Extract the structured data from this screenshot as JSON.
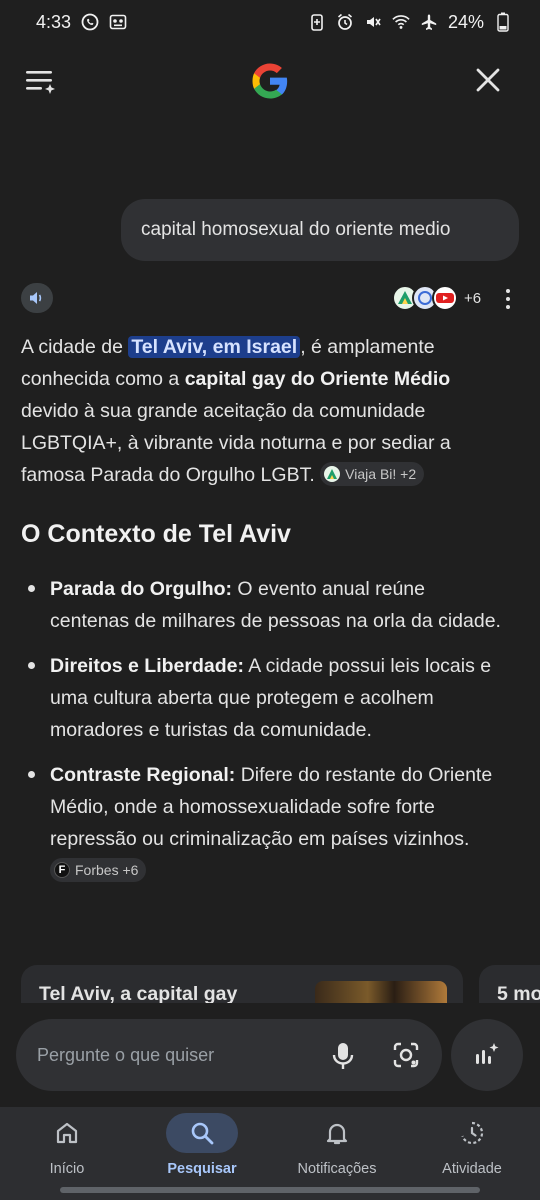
{
  "status_bar": {
    "time": "4:33",
    "battery": "24%",
    "left_icons": [
      "whatsapp-icon",
      "voicemail-icon"
    ],
    "right_icons": [
      "battery-saver-icon",
      "alarm-icon",
      "mute-icon",
      "wifi-icon",
      "airplane-icon",
      "battery-icon"
    ]
  },
  "header": {
    "logo_letter": "G"
  },
  "query": {
    "text": "capital homosexual do oriente medio"
  },
  "sources_bar": {
    "count_label": "+6"
  },
  "answer": {
    "p1_a": "A cidade de ",
    "p1_highlight": "Tel Aviv, em Israel",
    "p1_b": ", é amplamente conhecida como a ",
    "p1_bold": "capital gay do Oriente Médio",
    "p1_c": " devido à sua grande aceitação da comunidade LGBTQIA+, à vibrante vida noturna e por sediar a famosa Parada do Orgulho LGBT.",
    "p1_chip": "Viaja Bi! +2"
  },
  "section": {
    "title": "O Contexto de Tel Aviv"
  },
  "bullets": [
    {
      "label": "Parada do Orgulho:",
      "text": " O evento anual reúne centenas de milhares de pessoas na orla da cidade."
    },
    {
      "label": "Direitos e Liberdade:",
      "text": " A cidade possui leis locais e uma cultura aberta que protegem e acolhem moradores e turistas da comunidade."
    },
    {
      "label": "Contraste Regional:",
      "text": " Difere do restante do Oriente Médio, onde a homossexualidade sofre forte repressão ou criminalização em países vizinhos. ",
      "chip": "Forbes +6",
      "chip_icon_letter": "F"
    }
  ],
  "cards": [
    {
      "title": "Tel Aviv, a capital gay"
    },
    {
      "title": "5 mo"
    }
  ],
  "ask_bar": {
    "placeholder": "Pergunte o que quiser"
  },
  "bottom_nav": [
    {
      "label": "Início",
      "icon": "home-icon",
      "active": false
    },
    {
      "label": "Pesquisar",
      "icon": "search-icon",
      "active": true
    },
    {
      "label": "Notificações",
      "icon": "bell-icon",
      "active": false
    },
    {
      "label": "Atividade",
      "icon": "activity-icon",
      "active": false
    }
  ],
  "colors": {
    "background": "#1f1f1f",
    "highlight": "#1d3e8c",
    "active_nav": "#a8c7fa"
  }
}
